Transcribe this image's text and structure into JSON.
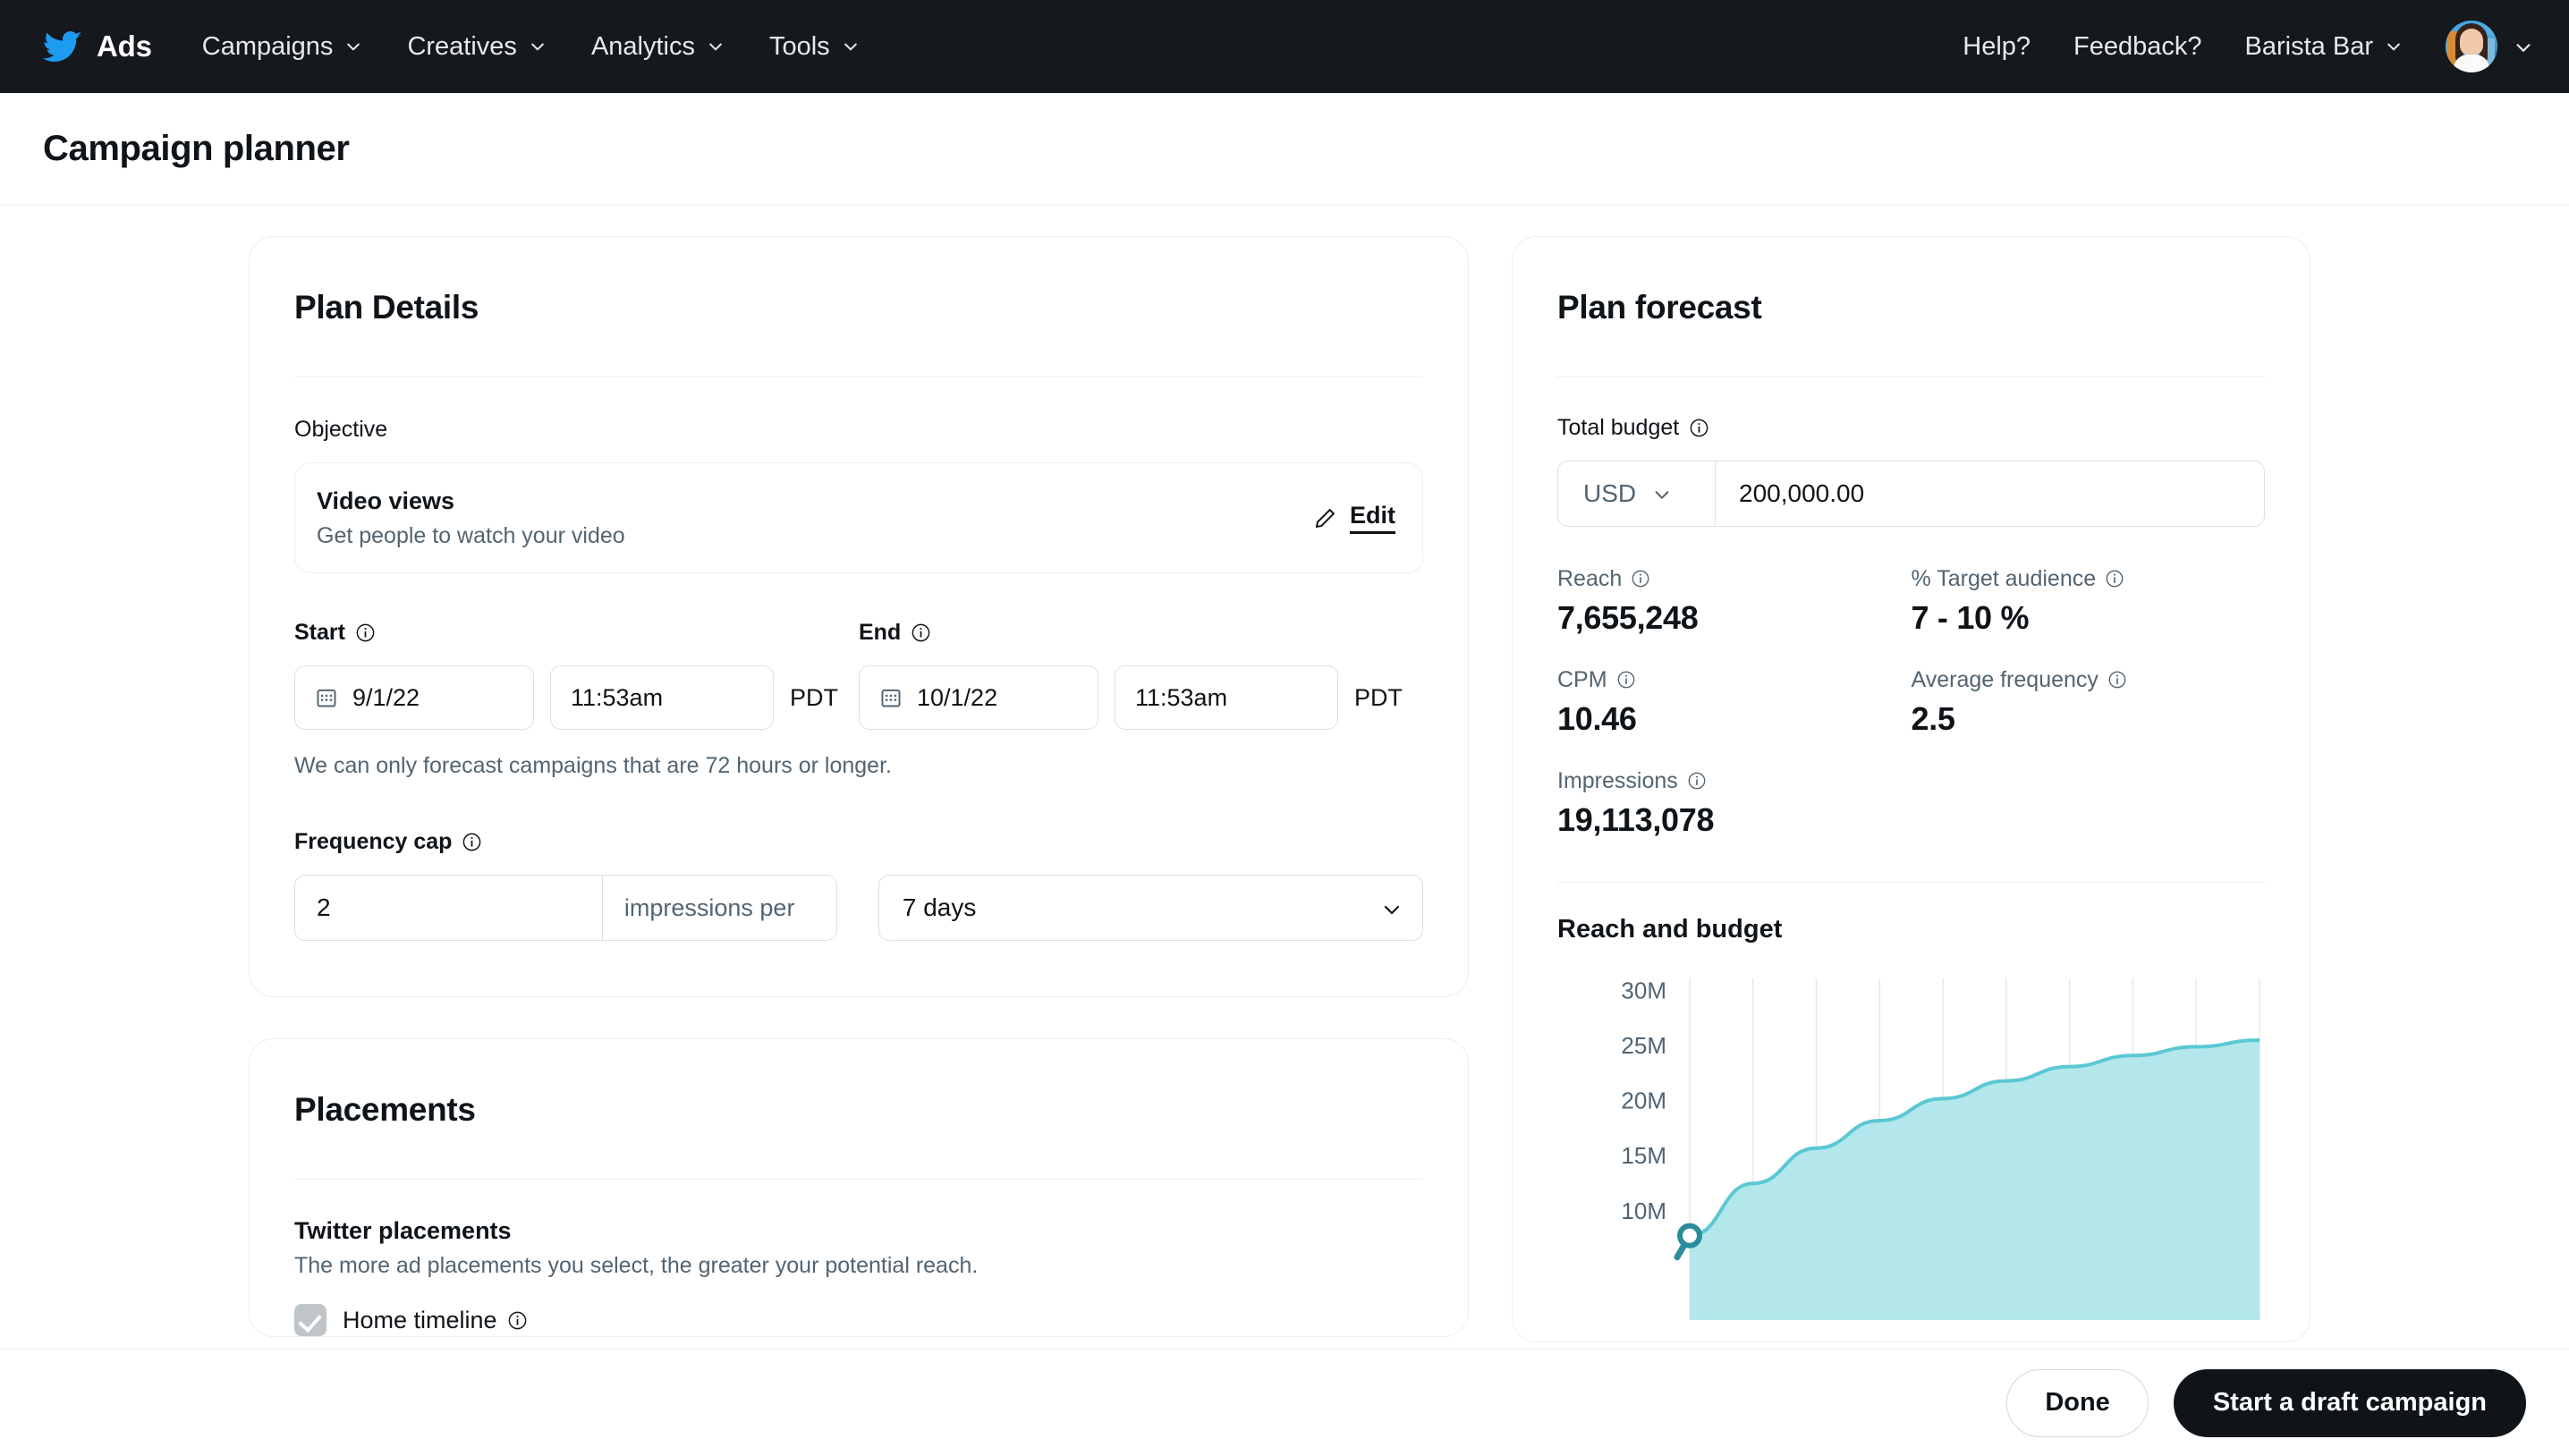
{
  "topnav": {
    "brand": "Ads",
    "logo_icon": "twitter-bird-icon",
    "brand_color": "#1D9BF0",
    "items": [
      {
        "label": "Campaigns",
        "icon": "chevron-down-icon"
      },
      {
        "label": "Creatives",
        "icon": "chevron-down-icon"
      },
      {
        "label": "Analytics",
        "icon": "chevron-down-icon"
      },
      {
        "label": "Tools",
        "icon": "chevron-down-icon"
      }
    ],
    "right_items": [
      {
        "label": "Help?"
      },
      {
        "label": "Feedback?"
      }
    ],
    "account": {
      "label": "Barista Bar",
      "icon": "chevron-down-icon"
    },
    "avatar_icon": "user-avatar",
    "avatar_menu_icon": "chevron-down-icon"
  },
  "page": {
    "title": "Campaign planner"
  },
  "plan_details": {
    "title": "Plan Details",
    "objective": {
      "label": "Objective",
      "name": "Video views",
      "description": "Get people to watch your video",
      "edit_label": "Edit",
      "edit_icon": "pencil-icon"
    },
    "start": {
      "label": "Start",
      "info_icon": "info-icon",
      "calendar_icon": "calendar-icon",
      "date": "9/1/22",
      "time": "11:53am",
      "timezone": "PDT"
    },
    "end": {
      "label": "End",
      "info_icon": "info-icon",
      "calendar_icon": "calendar-icon",
      "date": "10/1/22",
      "time": "11:53am",
      "timezone": "PDT"
    },
    "hint": "We can only forecast campaigns that are 72 hours or longer.",
    "frequency_cap": {
      "label": "Frequency cap",
      "info_icon": "info-icon",
      "count": "2",
      "unit": "impressions per",
      "period": "7 days",
      "period_icon": "chevron-down-icon"
    }
  },
  "placements": {
    "title": "Placements",
    "subtitle": "Twitter placements",
    "description": "The more ad placements you select, the greater your potential reach.",
    "option": {
      "label": "Home timeline",
      "checkbox_icon": "checkbox-checked-disabled-icon",
      "info_icon": "info-icon"
    }
  },
  "plan_forecast": {
    "title": "Plan forecast",
    "total_budget": {
      "label": "Total budget",
      "info_icon": "info-icon",
      "currency": "USD",
      "currency_icon": "chevron-down-icon",
      "amount": "200,000.00"
    },
    "metrics": [
      {
        "label": "Reach",
        "value": "7,655,248",
        "info_icon": "info-icon"
      },
      {
        "label": "% Target audience",
        "value": "7 - 10 %",
        "info_icon": "info-icon"
      },
      {
        "label": "CPM",
        "value": "10.46",
        "info_icon": "info-icon"
      },
      {
        "label": "Average frequency",
        "value": "2.5",
        "info_icon": "info-icon"
      },
      {
        "label": "Impressions",
        "value": "19,113,078",
        "info_icon": "info-icon"
      }
    ]
  },
  "chart_data": {
    "type": "area",
    "title": "Reach and budget",
    "xlabel": "",
    "ylabel": "",
    "ylim": [
      0,
      31000000
    ],
    "ytick_labels": [
      "30M",
      "25M",
      "20M",
      "15M",
      "10M"
    ],
    "ytick_values": [
      30000000,
      25000000,
      20000000,
      15000000,
      10000000
    ],
    "grid": "vertical",
    "legend": "none",
    "fill_color": "#B3E7EC",
    "line_color": "#5BC8D4",
    "marker_color": "#2B8C9B",
    "marker_point": {
      "x": 0,
      "y": 7655248
    },
    "x": [
      0,
      1,
      2,
      3,
      4,
      5,
      6,
      7,
      8,
      9
    ],
    "values": [
      7655248,
      12400000,
      15600000,
      18100000,
      20100000,
      21700000,
      23000000,
      24000000,
      24800000,
      25400000
    ]
  },
  "footer": {
    "done_label": "Done",
    "draft_label": "Start a draft campaign"
  }
}
